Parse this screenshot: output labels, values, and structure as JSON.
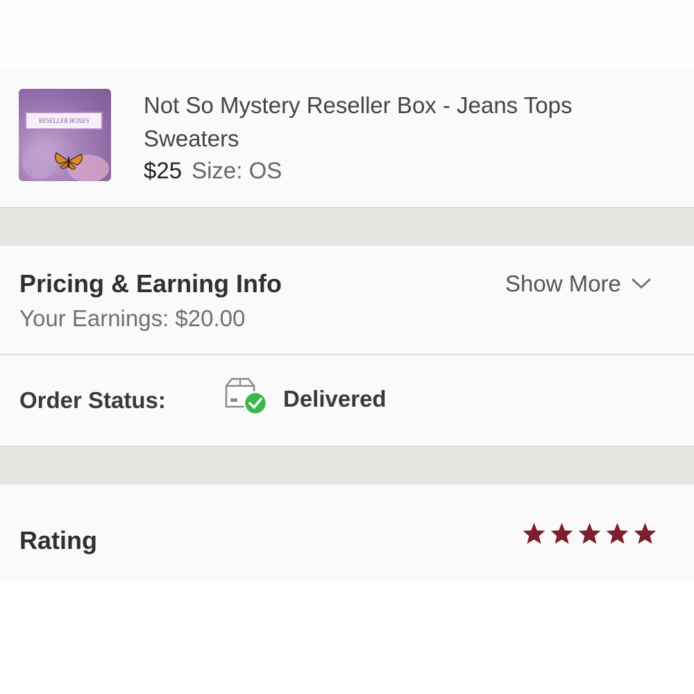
{
  "product": {
    "thumbnail_label": "RESELLER BOXES",
    "title": "Not So Mystery Reseller Box - Jeans Tops Sweaters",
    "price": "$25",
    "size": "Size: OS"
  },
  "pricing": {
    "title": "Pricing & Earning Info",
    "earnings": "Your Earnings: $20.00",
    "show_more_label": "Show More"
  },
  "order_status": {
    "label": "Order Status:",
    "value": "Delivered",
    "icon": "box-delivered-check-icon"
  },
  "rating": {
    "label": "Rating",
    "stars": 5,
    "max_stars": 5,
    "star_color": "#7c1e2c"
  },
  "colors": {
    "accent": "#7c1e2c",
    "success": "#3cb54a",
    "separator": "#e7e5e1"
  }
}
